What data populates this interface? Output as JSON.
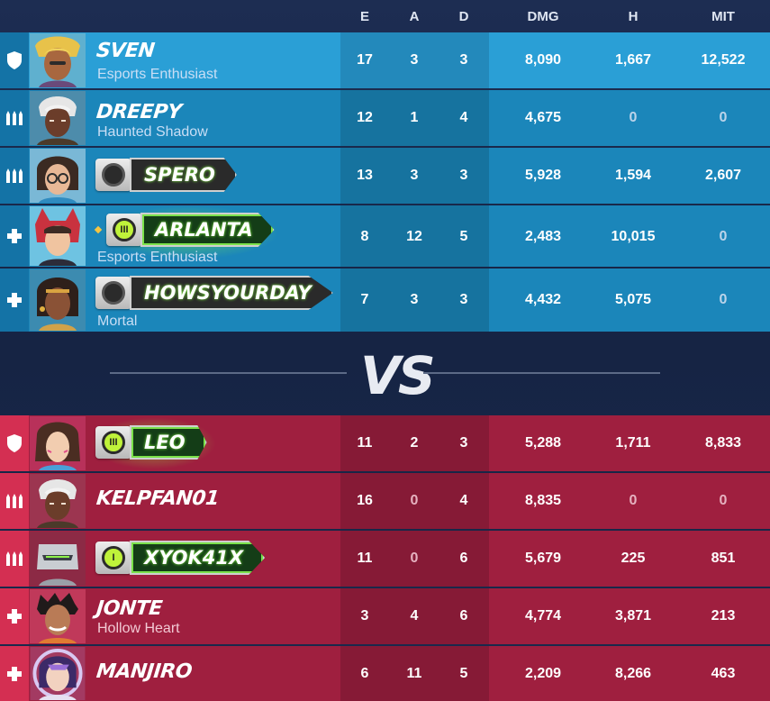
{
  "header": {
    "e": "E",
    "a": "A",
    "d": "D",
    "dmg": "DMG",
    "h": "H",
    "mit": "MIT"
  },
  "vs_label": "VS",
  "colors": {
    "team_blue": "#1b86ba",
    "team_red": "#9f1f3f",
    "plate_glow": "#7be24a"
  },
  "blue_team": [
    {
      "role": "tank",
      "role_icon": "shield-icon",
      "name": "SVEN",
      "title": "Esports Enthusiast",
      "e": "17",
      "a": "3",
      "d": "3",
      "dmg": "8,090",
      "h": "1,667",
      "mit": "12,522"
    },
    {
      "role": "damage",
      "role_icon": "bullets-icon",
      "name": "DREEPY",
      "title": "Haunted Shadow",
      "e": "12",
      "a": "1",
      "d": "4",
      "dmg": "4,675",
      "h": "0",
      "mit": "0"
    },
    {
      "role": "damage",
      "role_icon": "bullets-icon",
      "name": "SPERO",
      "e": "13",
      "a": "3",
      "d": "3",
      "dmg": "5,928",
      "h": "1,594",
      "mit": "2,607"
    },
    {
      "role": "support",
      "role_icon": "cross-icon",
      "name": "ARLANTA",
      "badge": "III",
      "title": "Esports Enthusiast",
      "e": "8",
      "a": "12",
      "d": "5",
      "dmg": "2,483",
      "h": "10,015",
      "mit": "0"
    },
    {
      "role": "support",
      "role_icon": "cross-icon",
      "name": "HOWSYOURDAY",
      "title": "Mortal",
      "e": "7",
      "a": "3",
      "d": "3",
      "dmg": "4,432",
      "h": "5,075",
      "mit": "0"
    }
  ],
  "red_team": [
    {
      "role": "tank",
      "role_icon": "shield-icon",
      "name": "LEO",
      "badge": "III",
      "e": "11",
      "a": "2",
      "d": "3",
      "dmg": "5,288",
      "h": "1,711",
      "mit": "8,833"
    },
    {
      "role": "damage",
      "role_icon": "bullets-icon",
      "name": "KELPFAN01",
      "e": "16",
      "a": "0",
      "d": "4",
      "dmg": "8,835",
      "h": "0",
      "mit": "0"
    },
    {
      "role": "damage",
      "role_icon": "bullets-icon",
      "name": "XYOK41X",
      "badge": "I",
      "e": "11",
      "a": "0",
      "d": "6",
      "dmg": "5,679",
      "h": "225",
      "mit": "851"
    },
    {
      "role": "support",
      "role_icon": "cross-icon",
      "name": "JONTE",
      "title": "Hollow Heart",
      "e": "3",
      "a": "4",
      "d": "6",
      "dmg": "4,774",
      "h": "3,871",
      "mit": "213"
    },
    {
      "role": "support",
      "role_icon": "cross-icon",
      "name": "MANJIRO",
      "e": "6",
      "a": "11",
      "d": "5",
      "dmg": "2,209",
      "h": "8,266",
      "mit": "463"
    }
  ]
}
